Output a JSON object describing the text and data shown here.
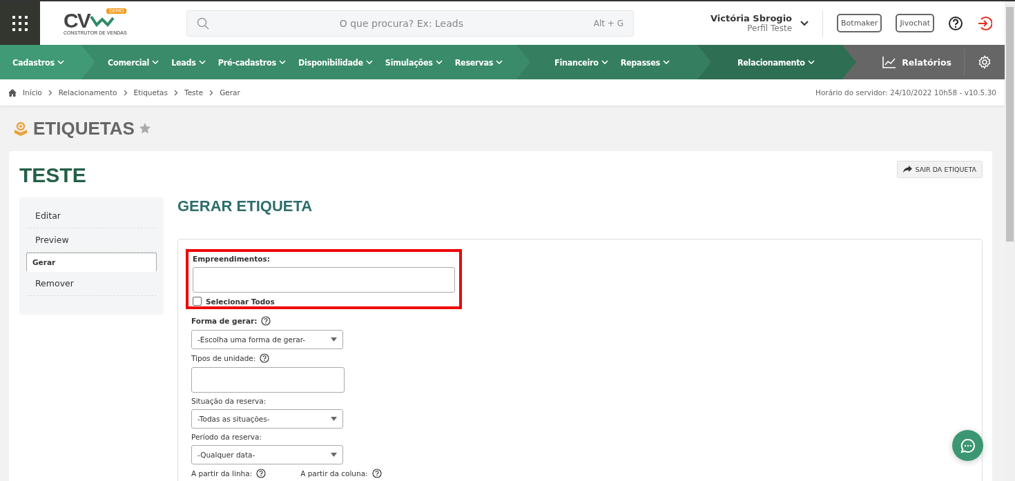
{
  "header": {
    "logo": {
      "mark": "CV",
      "badge": "DEMO",
      "tagline": "CONSTRUTOR DE VENDAS"
    },
    "search": {
      "placeholder": "O que procura? Ex: Leads",
      "shortcut": "Alt + G"
    },
    "user": {
      "name": "Victória Sbrogio",
      "profile": "Perfil Teste"
    },
    "buttons": [
      "Botmaker",
      "Jivochat"
    ]
  },
  "nav": {
    "groups": [
      {
        "color": "#3f9a75",
        "items": [
          "Cadastros"
        ]
      },
      {
        "color": "#3a8b69",
        "items": [
          "Comercial",
          "Leads",
          "Pré-cadastros",
          "Disponibilidade",
          "Simulações",
          "Reservas"
        ]
      },
      {
        "color": "#357f60",
        "items": [
          "Financeiro",
          "Repasses"
        ]
      },
      {
        "color": "#2e6e52",
        "items": [
          "Relacionamento"
        ]
      }
    ],
    "reports": "Relatórios"
  },
  "breadcrumb": {
    "items": [
      "Início",
      "Relacionamento",
      "Etiquetas",
      "Teste",
      "Gerar"
    ],
    "server_time": "Horário do servidor: 24/10/2022 10h58 - v10.5.30"
  },
  "page_title": "ETIQUETAS",
  "record_title": "TESTE",
  "exit_button": "SAIR DA ETIQUETA",
  "side_menu": [
    {
      "label": "Editar",
      "selected": false
    },
    {
      "label": "Preview",
      "selected": false
    },
    {
      "label": "Gerar",
      "selected": true
    },
    {
      "label": "Remover",
      "selected": false
    }
  ],
  "section_title": "GERAR ETIQUETA",
  "fields": [
    {
      "kind": "multiselect",
      "label": "Empreendimentos:",
      "bold": true,
      "highlighted": true,
      "select_all": {
        "label": "Selecionar Todos",
        "checked": false
      }
    },
    {
      "kind": "select",
      "label": "Forma de gerar:",
      "bold": true,
      "help": true,
      "highlighted": false,
      "value": "-Escolha uma forma de gerar-"
    },
    {
      "kind": "multiselect",
      "label": "Tipos de unidade:",
      "bold": false,
      "help": true,
      "highlighted": false
    },
    {
      "kind": "select",
      "label": "Situação da reserva:",
      "bold": false,
      "highlighted": false,
      "value": "-Todas as situações-"
    },
    {
      "kind": "select",
      "label": "Período da reserva:",
      "bold": false,
      "highlighted": false,
      "value": "-Qualquer data-"
    },
    {
      "kind": "labels",
      "items": [
        {
          "label": "A partir da linha:",
          "help": true
        },
        {
          "label": "A partir da coluna:",
          "help": true
        }
      ]
    }
  ]
}
